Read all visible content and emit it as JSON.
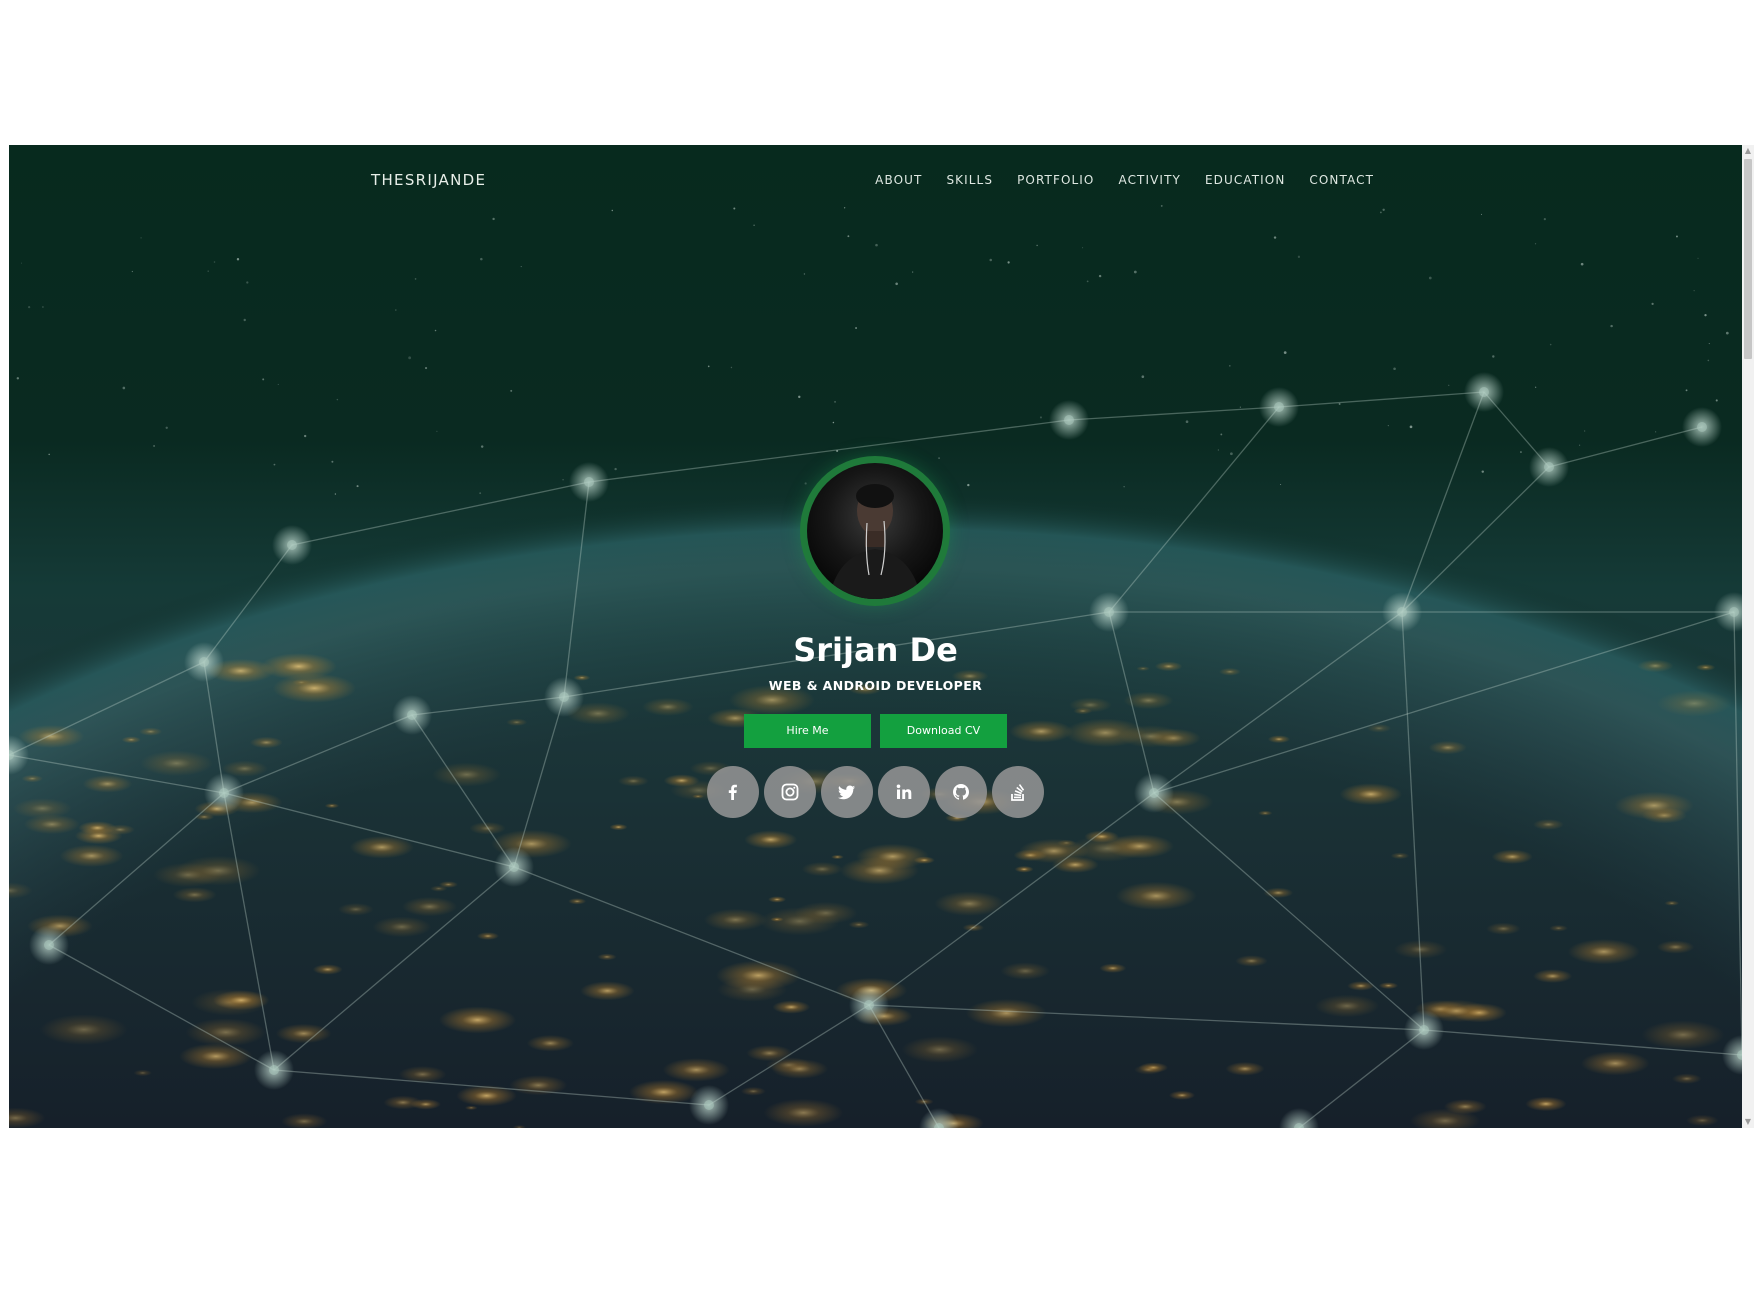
{
  "navbar": {
    "brand": "THESRIJANDE",
    "links": [
      "ABOUT",
      "SKILLS",
      "PORTFOLIO",
      "ACTIVITY",
      "EDUCATION",
      "CONTACT"
    ]
  },
  "hero": {
    "name": "Srijan De",
    "subtitle": "WEB & ANDROID DEVELOPER",
    "buttons": {
      "hire": "Hire Me",
      "download": "Download CV"
    },
    "social_icons": [
      "facebook-icon",
      "instagram-icon",
      "twitter-icon",
      "linkedin-icon",
      "github-icon",
      "stackoverflow-icon"
    ]
  },
  "colors": {
    "accent": "#13a03f",
    "ring": "#1f7a3a",
    "social_bg": "#969696"
  }
}
